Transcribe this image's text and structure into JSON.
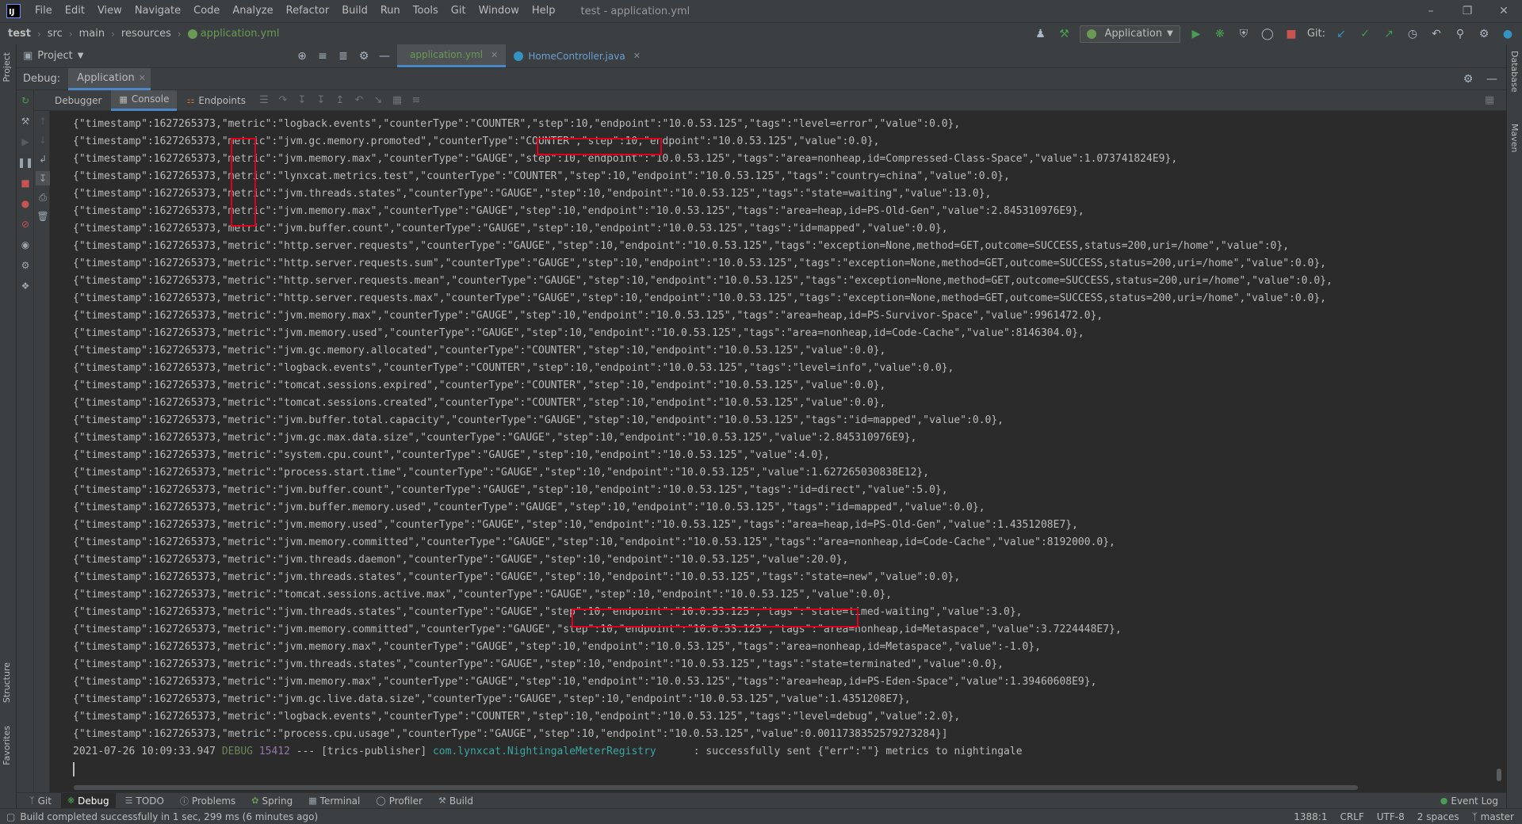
{
  "menubar": {
    "items": [
      "File",
      "Edit",
      "View",
      "Navigate",
      "Code",
      "Analyze",
      "Refactor",
      "Build",
      "Run",
      "Tools",
      "Git",
      "Window",
      "Help"
    ],
    "window_title": "test - application.yml"
  },
  "breadcrumbs": [
    "test",
    "src",
    "main",
    "resources",
    "application.yml"
  ],
  "toolbar": {
    "run_config": "Application",
    "git_label": "Git:"
  },
  "project_panel": {
    "title": "Project"
  },
  "editor_tabs": [
    {
      "label": "application.yml",
      "active": true
    },
    {
      "label": "HomeController.java",
      "active": false
    }
  ],
  "debug": {
    "label": "Debug:",
    "session": "Application",
    "subtabs": [
      "Debugger",
      "Console",
      "Endpoints"
    ],
    "active_subtab": "Console"
  },
  "console": {
    "lines": [
      "{\"timestamp\":1627265373,\"metric\":\"logback.events\",\"counterType\":\"COUNTER\",\"step\":10,\"endpoint\":\"10.0.53.125\",\"tags\":\"level=error\",\"value\":0.0},",
      "{\"timestamp\":1627265373,\"metric\":\"jvm.gc.memory.promoted\",\"counterType\":\"COUNTER\",\"step\":10,\"endpoint\":\"10.0.53.125\",\"value\":0.0},",
      "{\"timestamp\":1627265373,\"metric\":\"jvm.memory.max\",\"counterType\":\"GAUGE\",\"step\":10,\"endpoint\":\"10.0.53.125\",\"tags\":\"area=nonheap,id=Compressed-Class-Space\",\"value\":1.073741824E9},",
      "{\"timestamp\":1627265373,\"metric\":\"lynxcat.metrics.test\",\"counterType\":\"COUNTER\",\"step\":10,\"endpoint\":\"10.0.53.125\",\"tags\":\"country=china\",\"value\":0.0},",
      "{\"timestamp\":1627265373,\"metric\":\"jvm.threads.states\",\"counterType\":\"GAUGE\",\"step\":10,\"endpoint\":\"10.0.53.125\",\"tags\":\"state=waiting\",\"value\":13.0},",
      "{\"timestamp\":1627265373,\"metric\":\"jvm.memory.max\",\"counterType\":\"GAUGE\",\"step\":10,\"endpoint\":\"10.0.53.125\",\"tags\":\"area=heap,id=PS-Old-Gen\",\"value\":2.845310976E9},",
      "{\"timestamp\":1627265373,\"metric\":\"jvm.buffer.count\",\"counterType\":\"GAUGE\",\"step\":10,\"endpoint\":\"10.0.53.125\",\"tags\":\"id=mapped\",\"value\":0.0},",
      "{\"timestamp\":1627265373,\"metric\":\"http.server.requests\",\"counterType\":\"GAUGE\",\"step\":10,\"endpoint\":\"10.0.53.125\",\"tags\":\"exception=None,method=GET,outcome=SUCCESS,status=200,uri=/home\",\"value\":0},",
      "{\"timestamp\":1627265373,\"metric\":\"http.server.requests.sum\",\"counterType\":\"GAUGE\",\"step\":10,\"endpoint\":\"10.0.53.125\",\"tags\":\"exception=None,method=GET,outcome=SUCCESS,status=200,uri=/home\",\"value\":0.0},",
      "{\"timestamp\":1627265373,\"metric\":\"http.server.requests.mean\",\"counterType\":\"GAUGE\",\"step\":10,\"endpoint\":\"10.0.53.125\",\"tags\":\"exception=None,method=GET,outcome=SUCCESS,status=200,uri=/home\",\"value\":0.0},",
      "{\"timestamp\":1627265373,\"metric\":\"http.server.requests.max\",\"counterType\":\"GAUGE\",\"step\":10,\"endpoint\":\"10.0.53.125\",\"tags\":\"exception=None,method=GET,outcome=SUCCESS,status=200,uri=/home\",\"value\":0.0},",
      "{\"timestamp\":1627265373,\"metric\":\"jvm.memory.max\",\"counterType\":\"GAUGE\",\"step\":10,\"endpoint\":\"10.0.53.125\",\"tags\":\"area=heap,id=PS-Survivor-Space\",\"value\":9961472.0},",
      "{\"timestamp\":1627265373,\"metric\":\"jvm.memory.used\",\"counterType\":\"GAUGE\",\"step\":10,\"endpoint\":\"10.0.53.125\",\"tags\":\"area=nonheap,id=Code-Cache\",\"value\":8146304.0},",
      "{\"timestamp\":1627265373,\"metric\":\"jvm.gc.memory.allocated\",\"counterType\":\"COUNTER\",\"step\":10,\"endpoint\":\"10.0.53.125\",\"value\":0.0},",
      "{\"timestamp\":1627265373,\"metric\":\"logback.events\",\"counterType\":\"COUNTER\",\"step\":10,\"endpoint\":\"10.0.53.125\",\"tags\":\"level=info\",\"value\":0.0},",
      "{\"timestamp\":1627265373,\"metric\":\"tomcat.sessions.expired\",\"counterType\":\"COUNTER\",\"step\":10,\"endpoint\":\"10.0.53.125\",\"value\":0.0},",
      "{\"timestamp\":1627265373,\"metric\":\"tomcat.sessions.created\",\"counterType\":\"COUNTER\",\"step\":10,\"endpoint\":\"10.0.53.125\",\"value\":0.0},",
      "{\"timestamp\":1627265373,\"metric\":\"jvm.buffer.total.capacity\",\"counterType\":\"GAUGE\",\"step\":10,\"endpoint\":\"10.0.53.125\",\"tags\":\"id=mapped\",\"value\":0.0},",
      "{\"timestamp\":1627265373,\"metric\":\"jvm.gc.max.data.size\",\"counterType\":\"GAUGE\",\"step\":10,\"endpoint\":\"10.0.53.125\",\"value\":2.845310976E9},",
      "{\"timestamp\":1627265373,\"metric\":\"system.cpu.count\",\"counterType\":\"GAUGE\",\"step\":10,\"endpoint\":\"10.0.53.125\",\"value\":4.0},",
      "{\"timestamp\":1627265373,\"metric\":\"process.start.time\",\"counterType\":\"GAUGE\",\"step\":10,\"endpoint\":\"10.0.53.125\",\"value\":1.627265030838E12},",
      "{\"timestamp\":1627265373,\"metric\":\"jvm.buffer.count\",\"counterType\":\"GAUGE\",\"step\":10,\"endpoint\":\"10.0.53.125\",\"tags\":\"id=direct\",\"value\":5.0},",
      "{\"timestamp\":1627265373,\"metric\":\"jvm.buffer.memory.used\",\"counterType\":\"GAUGE\",\"step\":10,\"endpoint\":\"10.0.53.125\",\"tags\":\"id=mapped\",\"value\":0.0},",
      "{\"timestamp\":1627265373,\"metric\":\"jvm.memory.used\",\"counterType\":\"GAUGE\",\"step\":10,\"endpoint\":\"10.0.53.125\",\"tags\":\"area=heap,id=PS-Old-Gen\",\"value\":1.4351208E7},",
      "{\"timestamp\":1627265373,\"metric\":\"jvm.memory.committed\",\"counterType\":\"GAUGE\",\"step\":10,\"endpoint\":\"10.0.53.125\",\"tags\":\"area=nonheap,id=Code-Cache\",\"value\":8192000.0},",
      "{\"timestamp\":1627265373,\"metric\":\"jvm.threads.daemon\",\"counterType\":\"GAUGE\",\"step\":10,\"endpoint\":\"10.0.53.125\",\"value\":20.0},",
      "{\"timestamp\":1627265373,\"metric\":\"jvm.threads.states\",\"counterType\":\"GAUGE\",\"step\":10,\"endpoint\":\"10.0.53.125\",\"tags\":\"state=new\",\"value\":0.0},",
      "{\"timestamp\":1627265373,\"metric\":\"tomcat.sessions.active.max\",\"counterType\":\"GAUGE\",\"step\":10,\"endpoint\":\"10.0.53.125\",\"value\":0.0},",
      "{\"timestamp\":1627265373,\"metric\":\"jvm.threads.states\",\"counterType\":\"GAUGE\",\"step\":10,\"endpoint\":\"10.0.53.125\",\"tags\":\"state=timed-waiting\",\"value\":3.0},",
      "{\"timestamp\":1627265373,\"metric\":\"jvm.memory.committed\",\"counterType\":\"GAUGE\",\"step\":10,\"endpoint\":\"10.0.53.125\",\"tags\":\"area=nonheap,id=Metaspace\",\"value\":3.7224448E7},",
      "{\"timestamp\":1627265373,\"metric\":\"jvm.memory.max\",\"counterType\":\"GAUGE\",\"step\":10,\"endpoint\":\"10.0.53.125\",\"tags\":\"area=nonheap,id=Metaspace\",\"value\":-1.0},",
      "{\"timestamp\":1627265373,\"metric\":\"jvm.threads.states\",\"counterType\":\"GAUGE\",\"step\":10,\"endpoint\":\"10.0.53.125\",\"tags\":\"state=terminated\",\"value\":0.0},",
      "{\"timestamp\":1627265373,\"metric\":\"jvm.memory.max\",\"counterType\":\"GAUGE\",\"step\":10,\"endpoint\":\"10.0.53.125\",\"tags\":\"area=heap,id=PS-Eden-Space\",\"value\":1.39460608E9},",
      "{\"timestamp\":1627265373,\"metric\":\"jvm.gc.live.data.size\",\"counterType\":\"GAUGE\",\"step\":10,\"endpoint\":\"10.0.53.125\",\"value\":1.4351208E7},",
      "{\"timestamp\":1627265373,\"metric\":\"logback.events\",\"counterType\":\"COUNTER\",\"step\":10,\"endpoint\":\"10.0.53.125\",\"tags\":\"level=debug\",\"value\":2.0},",
      "{\"timestamp\":1627265373,\"metric\":\"process.cpu.usage\",\"counterType\":\"GAUGE\",\"step\":10,\"endpoint\":\"10.0.53.125\",\"value\":0.0011738352579273284}]"
    ],
    "log_line": {
      "date": "2021-07-26 10:09:33.947",
      "level": "DEBUG",
      "pid": "15412",
      "sep": "---",
      "thread": "[trics-publisher]",
      "logger": "com.lynxcat.NightingaleMeterRegistry",
      "message": ": successfully sent {\"err\":\"\"} metrics to nightingale"
    }
  },
  "bottom_tools": [
    "Git",
    "Debug",
    "TODO",
    "Problems",
    "Spring",
    "Terminal",
    "Profiler",
    "Build"
  ],
  "active_bottom_tool": "Debug",
  "event_log": "Event Log",
  "status": {
    "message": "Build completed successfully in 1 sec, 299 ms (6 minutes ago)",
    "position": "1388:1",
    "line_sep": "CRLF",
    "encoding": "UTF-8",
    "indent": "2 spaces",
    "branch": "master"
  },
  "side_tabs": {
    "left": [
      "Project",
      "Structure",
      "Favorites"
    ],
    "right": [
      "Database",
      "Maven"
    ]
  },
  "colors": {
    "highlight": "#e0001b",
    "accent": "#4a88c7",
    "run_green": "#499c54",
    "stop_red": "#c75450"
  }
}
